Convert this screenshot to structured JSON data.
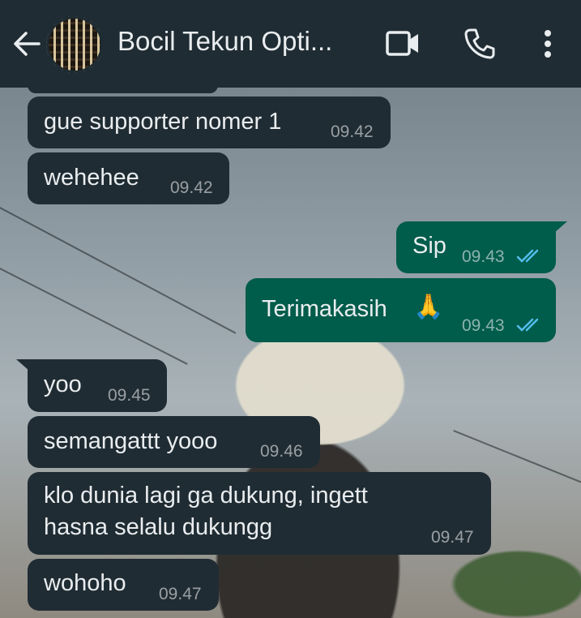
{
  "header": {
    "title": "Bocil Tekun Opti...",
    "icons": [
      "back-arrow-icon",
      "avatar",
      "video-call-icon",
      "voice-call-icon",
      "more-options-icon"
    ]
  },
  "messages": [
    {
      "dir": "in",
      "text": "gue supporter nomer 1",
      "time": "09.42"
    },
    {
      "dir": "in",
      "text": "wehehee",
      "time": "09.42"
    },
    {
      "dir": "out",
      "text": "Sip",
      "time": "09.43",
      "status": "read"
    },
    {
      "dir": "out",
      "text": "Terimakasih",
      "emoji": "🙏",
      "time": "09.43",
      "status": "read"
    },
    {
      "dir": "in",
      "text": "yoo",
      "time": "09.45"
    },
    {
      "dir": "in",
      "text": "semangattt yooo",
      "time": "09.46"
    },
    {
      "dir": "in",
      "text_line1": "klo dunia lagi ga dukung, ingett",
      "text_line2": "hasna selalu dukungg",
      "time": "09.47"
    },
    {
      "dir": "in",
      "text": "wohoho",
      "time": "09.47"
    }
  ],
  "colors": {
    "header_bg": "#1f2c33",
    "incoming_bubble": "#202c33",
    "outgoing_bubble": "#005c4b",
    "read_ticks": "#53bdeb"
  }
}
